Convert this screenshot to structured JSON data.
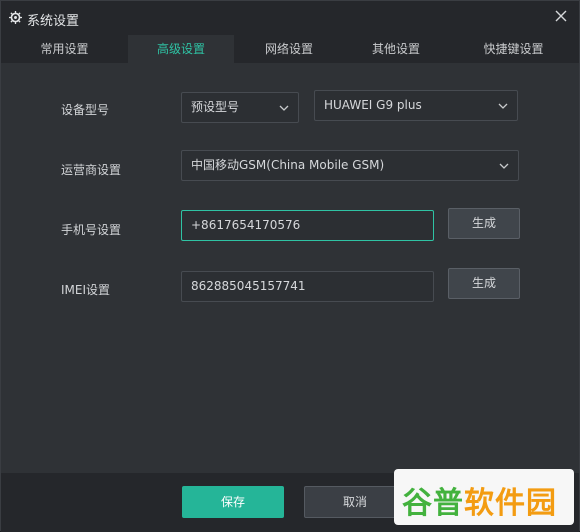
{
  "window": {
    "title": "系统设置",
    "title_icon": "gear-icon"
  },
  "tabs": [
    {
      "label": "常用设置",
      "active": false
    },
    {
      "label": "高级设置",
      "active": true
    },
    {
      "label": "网络设置",
      "active": false
    },
    {
      "label": "其他设置",
      "active": false
    },
    {
      "label": "快捷键设置",
      "active": false
    }
  ],
  "form": {
    "device_model": {
      "label": "设备型号",
      "preset_value": "预设型号",
      "model_value": "HUAWEI G9 plus"
    },
    "carrier": {
      "label": "运营商设置",
      "value": "中国移动GSM(China Mobile GSM)"
    },
    "phone": {
      "label": "手机号设置",
      "value": "+8617654170576",
      "generate_label": "生成"
    },
    "imei": {
      "label": "IMEI设置",
      "value": "862885045157741",
      "generate_label": "生成"
    }
  },
  "footer": {
    "save_label": "保存",
    "cancel_label": "取消"
  },
  "watermark": {
    "text_a": "谷普",
    "text_b": "软件园"
  },
  "colors": {
    "accent": "#2fc3a4",
    "save_button": "#25b598",
    "background": "#2f3236"
  }
}
